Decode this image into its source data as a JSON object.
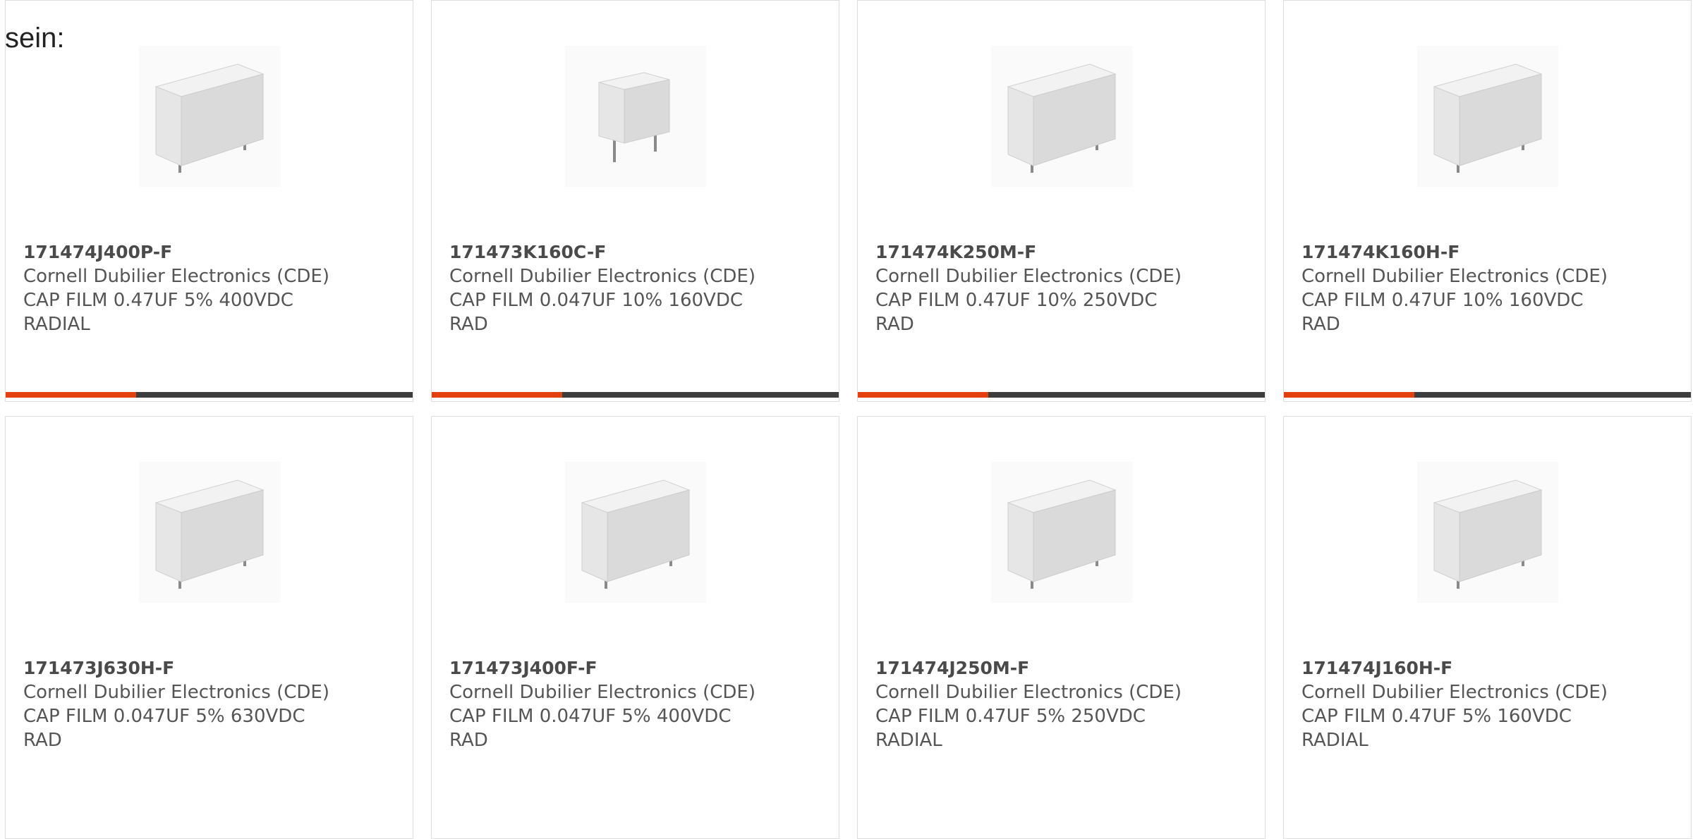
{
  "intro_text": "sein:",
  "accent_color": "#e2400e",
  "bar_track_color": "#3d3d3d",
  "products": [
    {
      "part_number": "171474J400P-F",
      "manufacturer": "Cornell Dubilier Electronics (CDE)",
      "description_line1": "CAP FILM 0.47UF 5% 400VDC",
      "description_line2": "RADIAL",
      "icon": "film-capacitor-image",
      "progress": 0.32
    },
    {
      "part_number": "171473K160C-F",
      "manufacturer": "Cornell Dubilier Electronics (CDE)",
      "description_line1": "CAP FILM 0.047UF 10% 160VDC",
      "description_line2": "RAD",
      "icon": "film-capacitor-image",
      "progress": 0.32
    },
    {
      "part_number": "171474K250M-F",
      "manufacturer": "Cornell Dubilier Electronics (CDE)",
      "description_line1": "CAP FILM 0.47UF 10% 250VDC",
      "description_line2": "RAD",
      "icon": "film-capacitor-image",
      "progress": 0.32
    },
    {
      "part_number": "171474K160H-F",
      "manufacturer": "Cornell Dubilier Electronics (CDE)",
      "description_line1": "CAP FILM 0.47UF 10% 160VDC",
      "description_line2": "RAD",
      "icon": "film-capacitor-image",
      "progress": 0.32
    },
    {
      "part_number": "171473J630H-F",
      "manufacturer": "Cornell Dubilier Electronics (CDE)",
      "description_line1": "CAP FILM 0.047UF 5% 630VDC",
      "description_line2": "RAD",
      "icon": "film-capacitor-image"
    },
    {
      "part_number": "171473J400F-F",
      "manufacturer": "Cornell Dubilier Electronics (CDE)",
      "description_line1": "CAP FILM 0.047UF 5% 400VDC",
      "description_line2": "RAD",
      "icon": "film-capacitor-image"
    },
    {
      "part_number": "171474J250M-F",
      "manufacturer": "Cornell Dubilier Electronics (CDE)",
      "description_line1": "CAP FILM 0.47UF 5% 250VDC",
      "description_line2": "RADIAL",
      "icon": "film-capacitor-image"
    },
    {
      "part_number": "171474J160H-F",
      "manufacturer": "Cornell Dubilier Electronics (CDE)",
      "description_line1": "CAP FILM 0.47UF 5% 160VDC",
      "description_line2": "RADIAL",
      "icon": "film-capacitor-image"
    }
  ]
}
